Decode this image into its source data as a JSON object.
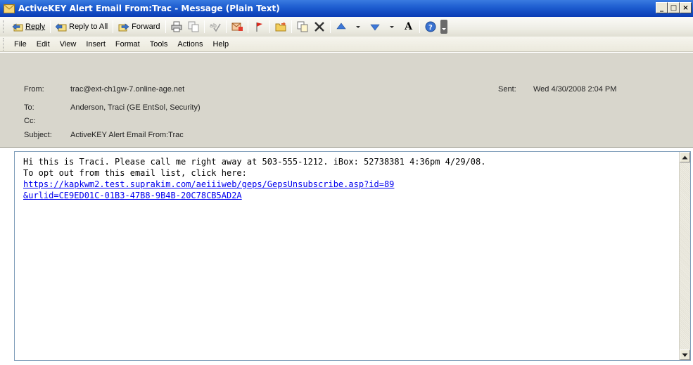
{
  "window": {
    "title": "ActiveKEY Alert Email From:Trac - Message (Plain Text)",
    "minimize": "_",
    "maximize": "□",
    "close": "×"
  },
  "toolbar": {
    "reply": "Reply",
    "reply_all": "Reply to All",
    "forward": "Forward",
    "font_size_icon": "A"
  },
  "menu": [
    "File",
    "Edit",
    "View",
    "Insert",
    "Format",
    "Tools",
    "Actions",
    "Help"
  ],
  "header": {
    "from_label": "From:",
    "from_value": "trac@ext-ch1gw-7.online-age.net",
    "sent_label": "Sent:",
    "sent_value": "Wed 4/30/2008 2:04 PM",
    "to_label": "To:",
    "to_value": "Anderson, Traci (GE EntSol, Security)",
    "cc_label": "Cc:",
    "cc_value": "",
    "subject_label": "Subject:",
    "subject_value": "ActiveKEY Alert Email From:Trac"
  },
  "body": {
    "line1": "Hi this is Traci. Please call me right away at 503-555-1212. iBox: 52738381 4:36pm 4/29/08.",
    "line2": "To opt out from this email list, click here:",
    "link1": "https://kapkwm2.test.suprakim.com/aeiiiweb/geps/GepsUnsubscribe.asp?id=89",
    "link2": "&urlid=CE9ED01C-01B3-47B8-9B4B-20C78CB5AD2A"
  },
  "colors": {
    "titlebar": "#0a3cb5",
    "header_bg": "#d8d6cc",
    "link": "#0000ee"
  }
}
